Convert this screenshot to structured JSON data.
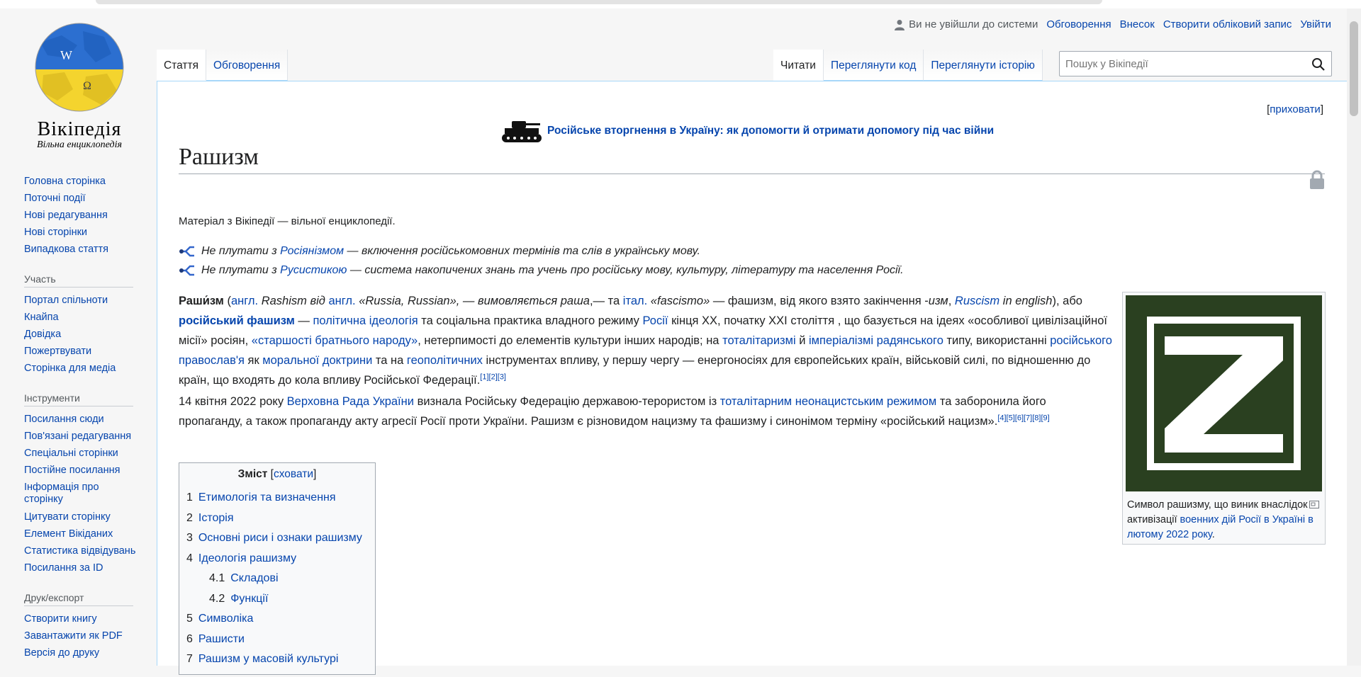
{
  "logo": {
    "wordmark": "Вікіпедія",
    "tagline": "Вільна енциклопедія"
  },
  "sidebar": {
    "nav": [
      "Головна сторінка",
      "Поточні події",
      "Нові редагування",
      "Нові сторінки",
      "Випадкова стаття"
    ],
    "participation": {
      "heading": "Участь",
      "items": [
        "Портал спільноти",
        "Кнайпа",
        "Довідка",
        "Пожертвувати",
        "Сторінка для медіа"
      ]
    },
    "tools": {
      "heading": "Інструменти",
      "items": [
        "Посилання сюди",
        "Пов'язані редагування",
        "Спеціальні сторінки",
        "Постійне посилання",
        "Інформація про сторінку",
        "Цитувати сторінку",
        "Елемент Вікіданих",
        "Статистика відвідувань",
        "Посилання за ID"
      ]
    },
    "print": {
      "heading": "Друк/експорт",
      "items": [
        "Створити книгу",
        "Завантажити як PDF",
        "Версія до друку"
      ]
    }
  },
  "personal": {
    "anon": "Ви не увійшли до системи",
    "talk": "Обговорення",
    "contrib": "Внесок",
    "create": "Створити обліковий запис",
    "login": "Увійти"
  },
  "tabs": {
    "article": "Стаття",
    "talk": "Обговорення",
    "read": "Читати",
    "viewsource": "Переглянути код",
    "history": "Переглянути історію"
  },
  "search": {
    "placeholder": "Пошук у Вікіпедії"
  },
  "content": {
    "hide": "приховати",
    "notice": "Російське вторгнення в Україну: як допомогти й отримати допомогу під час війни",
    "title": "Рашизм",
    "tagline": "Матеріал з Вікіпедії — вільної енциклопедії.",
    "hat1": {
      "pre": "Не плутати з ",
      "link": "Росіянізмом",
      "post": " — включення російськомовних термінів та слів в українську мову."
    },
    "hat2": {
      "pre": "Не плутати з ",
      "link": "Русистикою",
      "post": " — система накопичених знань та учень про російську мову, культуру, літературу та населення Росії."
    },
    "p1": {
      "t1": "Раши́зм",
      "t2": " (",
      "l1": "англ.",
      "t3": " Rashism від ",
      "l2": "англ.",
      "t4": " «Russia, Russian», — вимовляється ",
      "t5": "раша",
      "t6": ",— та ",
      "l3": "італ.",
      "t7": " «fascismo»",
      "t8": "  — фашизм, від якого взято закінчення -",
      "t9": "изм",
      "t10": ", ",
      "l4": "Ruscism",
      "t11": " in english",
      "t12": "), або ",
      "l5": "російський фашизм",
      "t13": " — ",
      "l6": "політична ідеологія",
      "t14": " та соціальна практика владного режиму ",
      "l7": "Росії",
      "t15": " кінця XX, початку XXI століття , що базується на ідеях «особливої цивілізаційної місії» росіян, ",
      "l8": "«старшості братнього народу»",
      "t16": ", нетерпимості до елементів культури інших народів; на ",
      "l9": "тоталітаризмі",
      "t17": " й ",
      "l10": "імперіалізмі радянського",
      "t18": " типу, використанні ",
      "l11": "російського православ'я",
      "t19": " як ",
      "l12": "моральної доктрини",
      "t20": " та на ",
      "l13": "геополітичних",
      "t21": " інструментах впливу, у першу чергу — енергоносіях для європейських країн, військовій силі, по відношенню до країн, що входять до кола впливу Російської Федерації.",
      "refs": "[1][2][3]"
    },
    "p2": {
      "t1": "14 квітня 2022 року ",
      "l1": "Верховна Рада України",
      "t2": " визнала Російську Федерацію державою-терористом із ",
      "l2": "тоталітарним неонацистським режимом",
      "t3": " та заборонила його пропаганду, а також пропаганду акту агресії Росії проти України. Рашизм є різновидом нацизму та фашизму і синонімом терміну «російський нацизм».",
      "refs": "[4][5][6][7][8][9]"
    },
    "infobox": {
      "cap_pre": "Символ рашизму, що виник внаслідок активізації ",
      "cap_link": "военних дій Росії в Україні в лютому 2022 року",
      "cap_post": "."
    },
    "toc": {
      "title": "Зміст",
      "toggle": "сховати",
      "items": [
        {
          "num": "1",
          "label": "Етимологія та визначення"
        },
        {
          "num": "2",
          "label": "Історія"
        },
        {
          "num": "3",
          "label": "Основні риси і ознаки рашизму"
        },
        {
          "num": "4",
          "label": "Ідеологія рашизму"
        },
        {
          "num": "4.1",
          "label": "Складові"
        },
        {
          "num": "4.2",
          "label": "Функції"
        },
        {
          "num": "5",
          "label": "Символіка"
        },
        {
          "num": "6",
          "label": "Рашисти"
        },
        {
          "num": "7",
          "label": "Рашизм у масовій культурі"
        }
      ]
    }
  },
  "colors": {
    "link": "#0645ad",
    "zsymbol_bg": "#2a4020"
  }
}
